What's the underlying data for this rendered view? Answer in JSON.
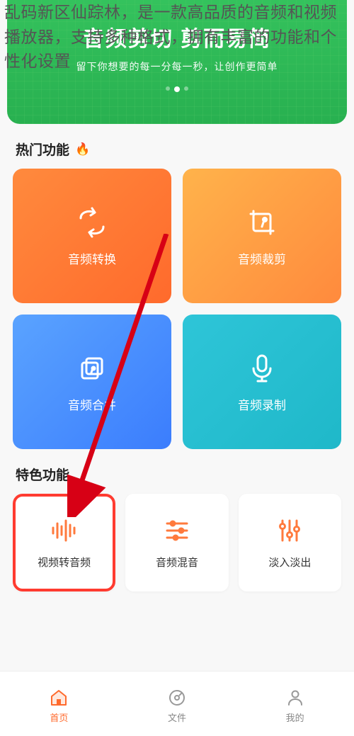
{
  "overlay_description": "乱码新区仙踪林，是一款高品质的音频和视频播放器，支持多种格式，拥有丰富的功能和个性化设置",
  "hero": {
    "title": "音频剪切 剪而易简",
    "subtitle": "留下你想要的每一分每一秒，让创作更简单"
  },
  "sections": {
    "hot_title": "热门功能",
    "feature_title": "特色功能"
  },
  "hot_cards": {
    "convert": "音频转换",
    "crop": "音频裁剪",
    "merge": "音频合并",
    "record": "音频录制"
  },
  "feature_cards": {
    "video_to_audio": "视频转音频",
    "mix": "音频混音",
    "fade": "淡入淡出"
  },
  "nav": {
    "home": "首页",
    "files": "文件",
    "mine": "我的"
  }
}
